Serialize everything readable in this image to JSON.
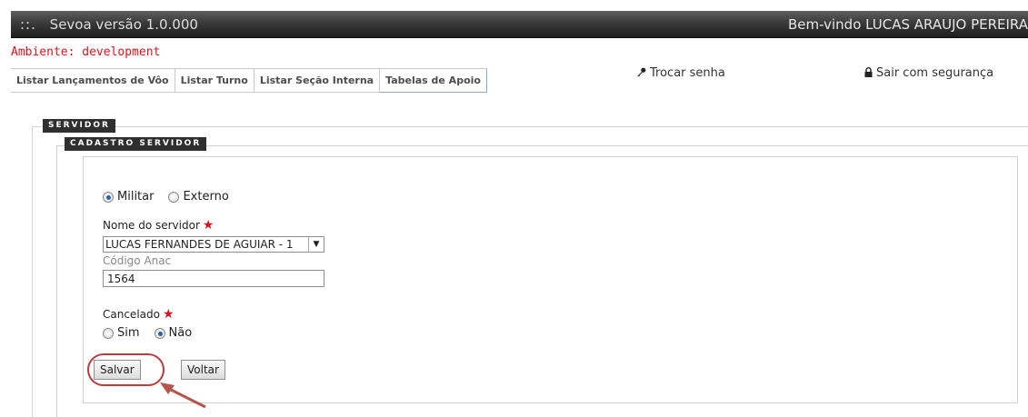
{
  "header": {
    "sep": "::.",
    "app_title": "Sevoa versão 1.0.000",
    "welcome": "Bem-vindo LUCAS ARAUJO PEREIRA"
  },
  "environment": "Ambiente: development",
  "menu": [
    "Listar Lançamentos de Vôo",
    "Listar Turno",
    "Listar Seção Interna",
    "Tabelas de Apoio"
  ],
  "links": {
    "change_password": "Trocar senha",
    "logout": "Sair com segurança"
  },
  "legends": {
    "outer": "SERVIDOR",
    "inner": "CADASTRO SERVIDOR"
  },
  "form": {
    "type_options": {
      "militar": "Militar",
      "externo": "Externo",
      "selected": "Militar"
    },
    "server_name_label": "Nome do servidor",
    "server_name_value": "LUCAS FERNANDES DE AGUIAR - 1",
    "anac_label": "Código Anac",
    "anac_value": "1564",
    "cancelled_label": "Cancelado",
    "cancelled_options": {
      "sim": "Sim",
      "nao": "Não",
      "selected": "Não"
    },
    "save_label": "Salvar",
    "back_label": "Voltar"
  },
  "colors": {
    "required_star": "#d4141c",
    "env_text": "#e8121a",
    "callout": "#c0393b"
  },
  "icons": {
    "password": "key-icon",
    "logout": "lock-icon",
    "dropdown": "chevron-down-icon",
    "required": "star-icon"
  }
}
